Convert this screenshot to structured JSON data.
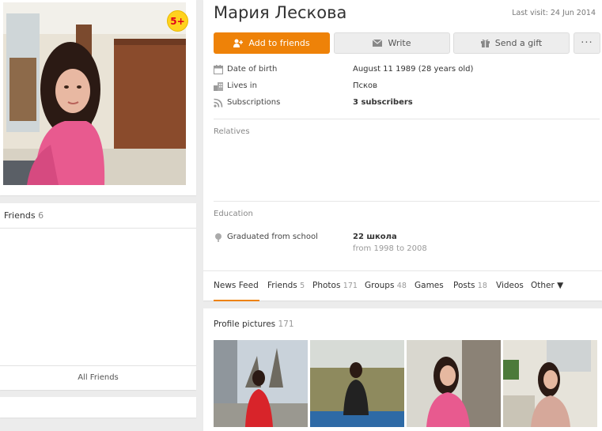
{
  "profile": {
    "name": "Мария Лескова",
    "last_visit": "Last visit: 24 Jun 2014",
    "age_badge": "5+"
  },
  "actions": {
    "add_friend": "Add to friends",
    "write": "Write",
    "gift": "Send a gift",
    "more": "···"
  },
  "info": [
    {
      "label": "Date of birth",
      "value": "August 11 1989 (28 years old)",
      "icon": "calendar-icon"
    },
    {
      "label": "Lives in",
      "value": "Псков",
      "icon": "building-icon"
    },
    {
      "label": "Subscriptions",
      "value": "3 subscribers",
      "icon": "rss-icon"
    }
  ],
  "sections": {
    "relatives": "Relatives",
    "education": "Education"
  },
  "education": {
    "label": "Graduated from school",
    "school": "22 школа",
    "period": "from 1998 to 2008"
  },
  "tabs": [
    {
      "label": "News Feed",
      "count": ""
    },
    {
      "label": "Friends",
      "count": "5"
    },
    {
      "label": "Photos",
      "count": "171"
    },
    {
      "label": "Groups",
      "count": "48"
    },
    {
      "label": "Games",
      "count": ""
    },
    {
      "label": "Posts",
      "count": "18"
    },
    {
      "label": "Videos",
      "count": ""
    },
    {
      "label": "Other ▼",
      "count": ""
    }
  ],
  "friends_card": {
    "title": "Friends",
    "count": "6",
    "all_friends": "All Friends"
  },
  "profile_pictures": {
    "title": "Profile pictures",
    "count": "171"
  },
  "colors": {
    "accent": "#ee8208",
    "badge": "#ffd21e",
    "background": "#ececec"
  }
}
